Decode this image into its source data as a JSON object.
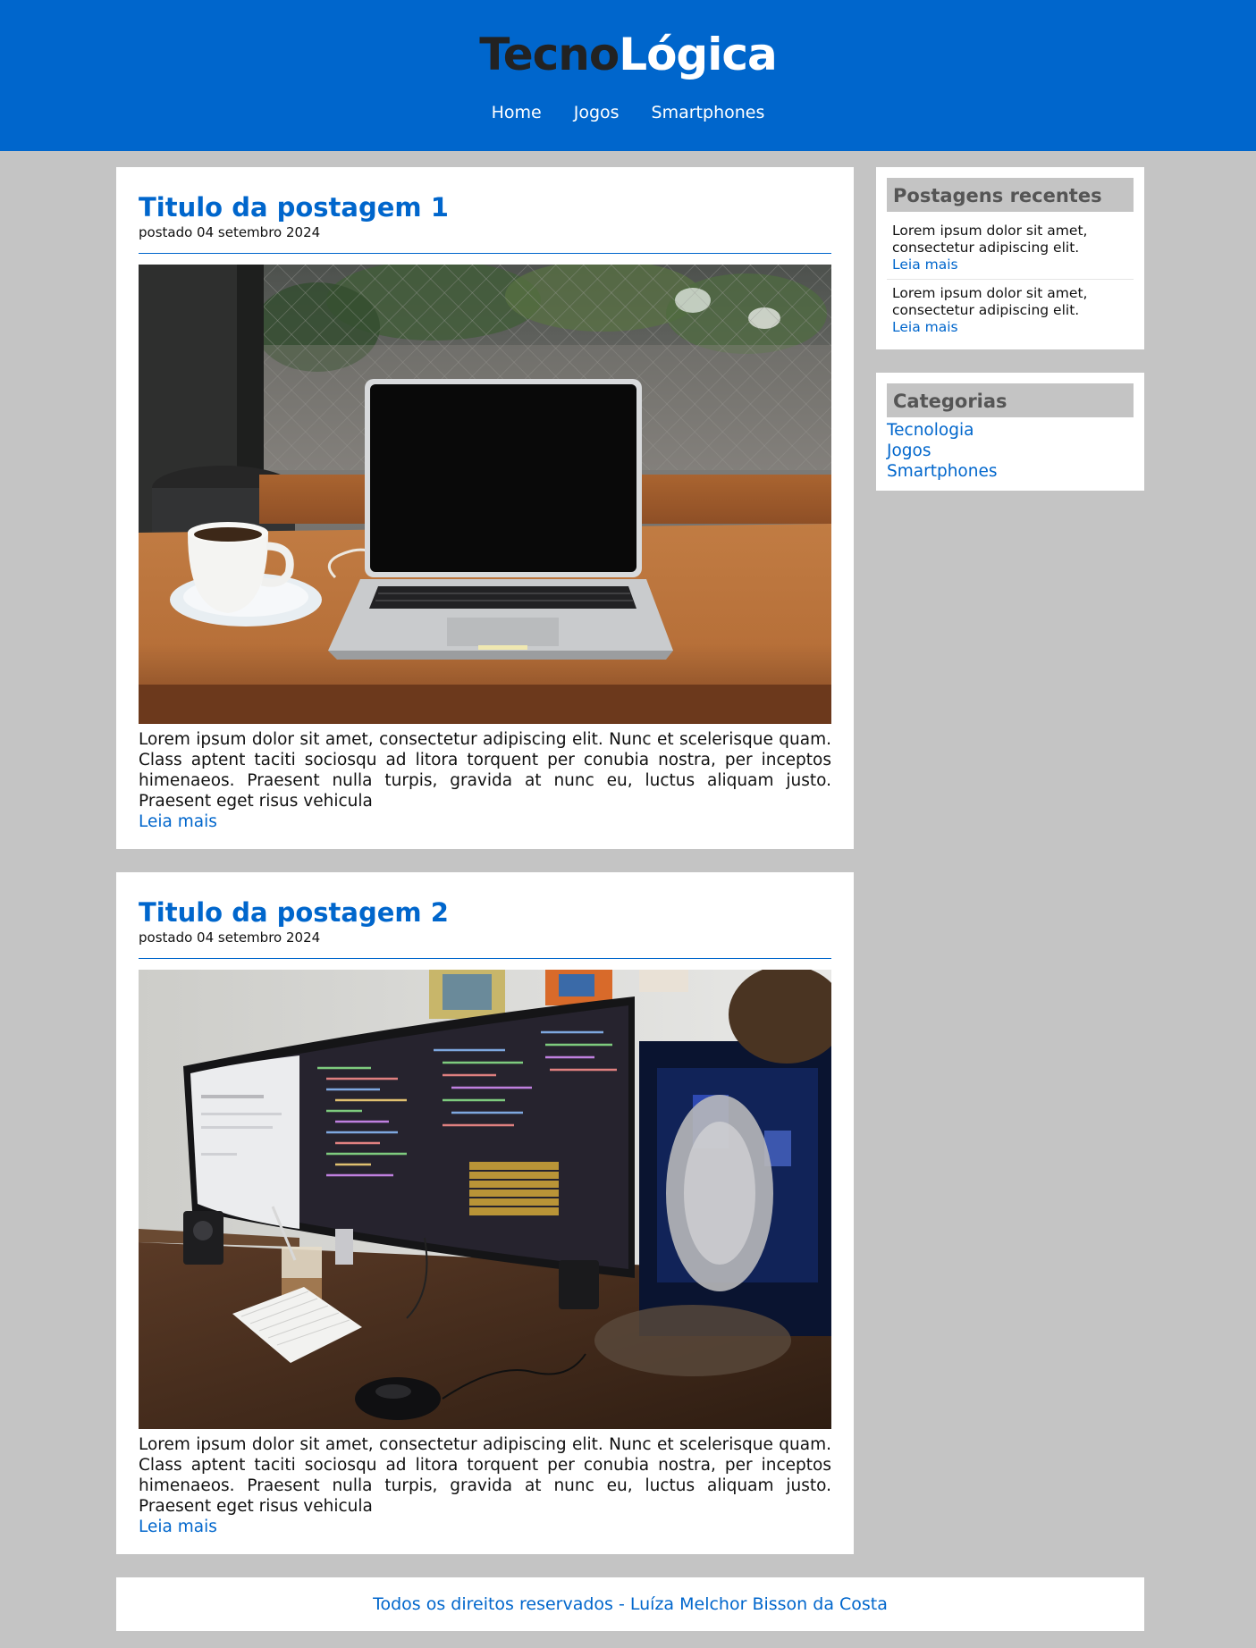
{
  "header": {
    "brand_part1": "Tecno",
    "brand_part2": "Lógica",
    "nav": [
      "Home",
      "Jogos",
      "Smartphones"
    ]
  },
  "posts": [
    {
      "title": "Titulo da postagem 1",
      "date": "postado 04 setembro 2024",
      "image_desc": "laptop-and-coffee-photo",
      "text": "Lorem ipsum dolor sit amet, consectetur adipiscing elit. Nunc et scelerisque quam. Class aptent taciti sociosqu ad litora torquent per conubia nostra, per inceptos himenaeos. Praesent nulla turpis, gravida at nunc eu, luctus aliquam justo. Praesent eget risus vehicula",
      "read_more": "Leia mais"
    },
    {
      "title": "Titulo da postagem 2",
      "date": "postado 04 setembro 2024",
      "image_desc": "desk-setup-photo",
      "text": "Lorem ipsum dolor sit amet, consectetur adipiscing elit. Nunc et scelerisque quam. Class aptent taciti sociosqu ad litora torquent per conubia nostra, per inceptos himenaeos. Praesent nulla turpis, gravida at nunc eu, luctus aliquam justo. Praesent eget risus vehicula",
      "read_more": "Leia mais"
    }
  ],
  "sidebar": {
    "recent": {
      "title": "Postagens recentes",
      "items": [
        {
          "text": "Lorem ipsum dolor sit amet, consectetur adipiscing elit.",
          "link": "Leia mais"
        },
        {
          "text": "Lorem ipsum dolor sit amet, consectetur adipiscing elit.",
          "link": "Leia mais"
        }
      ]
    },
    "categories": {
      "title": "Categorias",
      "items": [
        "Tecnologia",
        "Jogos",
        "Smartphones"
      ]
    }
  },
  "footer": {
    "text": "Todos os direitos reservados - Luíza Melchor Bisson da Costa"
  },
  "colors": {
    "primary": "#0066cc",
    "page_bg": "#c4c4c4",
    "widget_title_bg": "#c4c4c4",
    "brand_dark": "#222222"
  }
}
